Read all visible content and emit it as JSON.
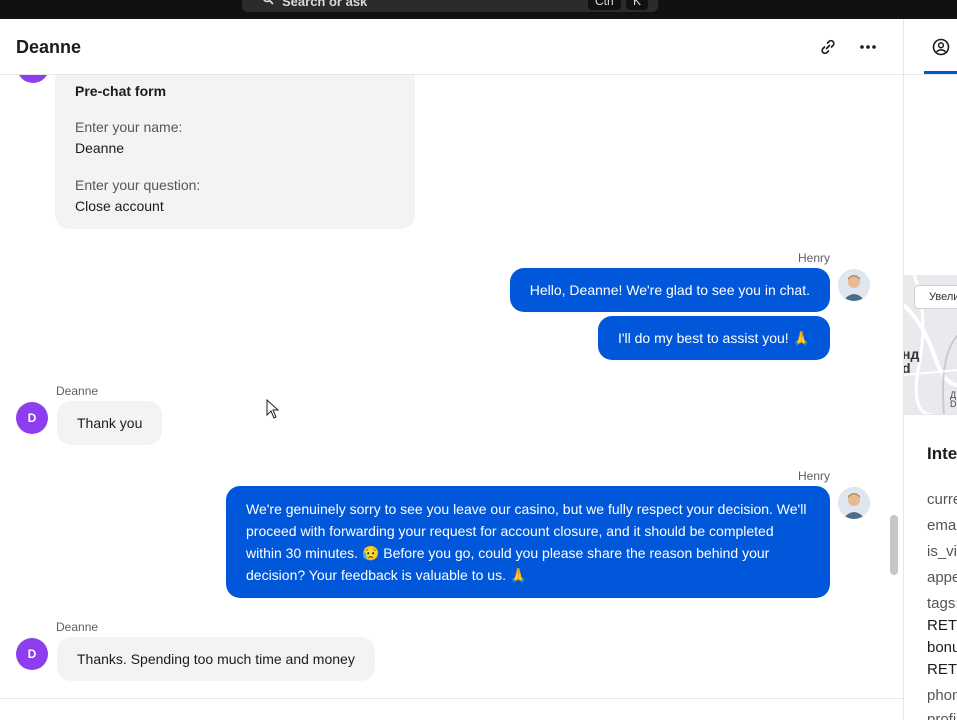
{
  "topbar": {
    "search_placeholder": "Search or ask",
    "shortcut_keys": [
      "Ctrl",
      "K"
    ]
  },
  "header": {
    "title": "Deanne",
    "icons": [
      "link-icon",
      "more-icon"
    ]
  },
  "side_panel": {
    "tab_icon": "user-circle-icon",
    "map": {
      "zoom_label": "Увели",
      "labels": [
        "нд",
        "d",
        "Д",
        "D"
      ]
    },
    "section_title": "Inte",
    "fields": [
      "curre",
      "emai",
      "is_vip",
      "appe",
      "tags:",
      "RETH",
      "bonu",
      "RETH",
      "phon",
      "profi"
    ]
  },
  "chat": {
    "pre_chat_form": {
      "title": "Pre-chat form",
      "name_label": "Enter your name:",
      "name_value": "Deanne",
      "question_label": "Enter your question:",
      "question_value": "Close account"
    },
    "messages": [
      {
        "sender": "Henry",
        "role": "agent",
        "texts": [
          "Hello, Deanne! We're glad to see you in chat.",
          "I'll do my best to assist you! 🙏"
        ]
      },
      {
        "sender": "Deanne",
        "role": "customer",
        "avatar_letter": "D",
        "texts": [
          "Thank you"
        ]
      },
      {
        "sender": "Henry",
        "role": "agent",
        "texts": [
          "We're genuinely sorry to see you leave our casino, but we fully respect your decision. We'll proceed with forwarding your request for account closure, and it should be completed within 30 minutes. 😥 Before you go, could you please share the reason behind your decision? Your feedback is valuable to us. 🙏"
        ]
      },
      {
        "sender": "Deanne",
        "role": "customer",
        "avatar_letter": "D",
        "texts": [
          "Thanks. Spending too much time and money"
        ]
      }
    ]
  },
  "colors": {
    "agent_bubble": "#0057d9",
    "customer_bubble": "#f3f3f4",
    "customer_avatar": "#8d3ff0",
    "accent": "#0057d9"
  }
}
